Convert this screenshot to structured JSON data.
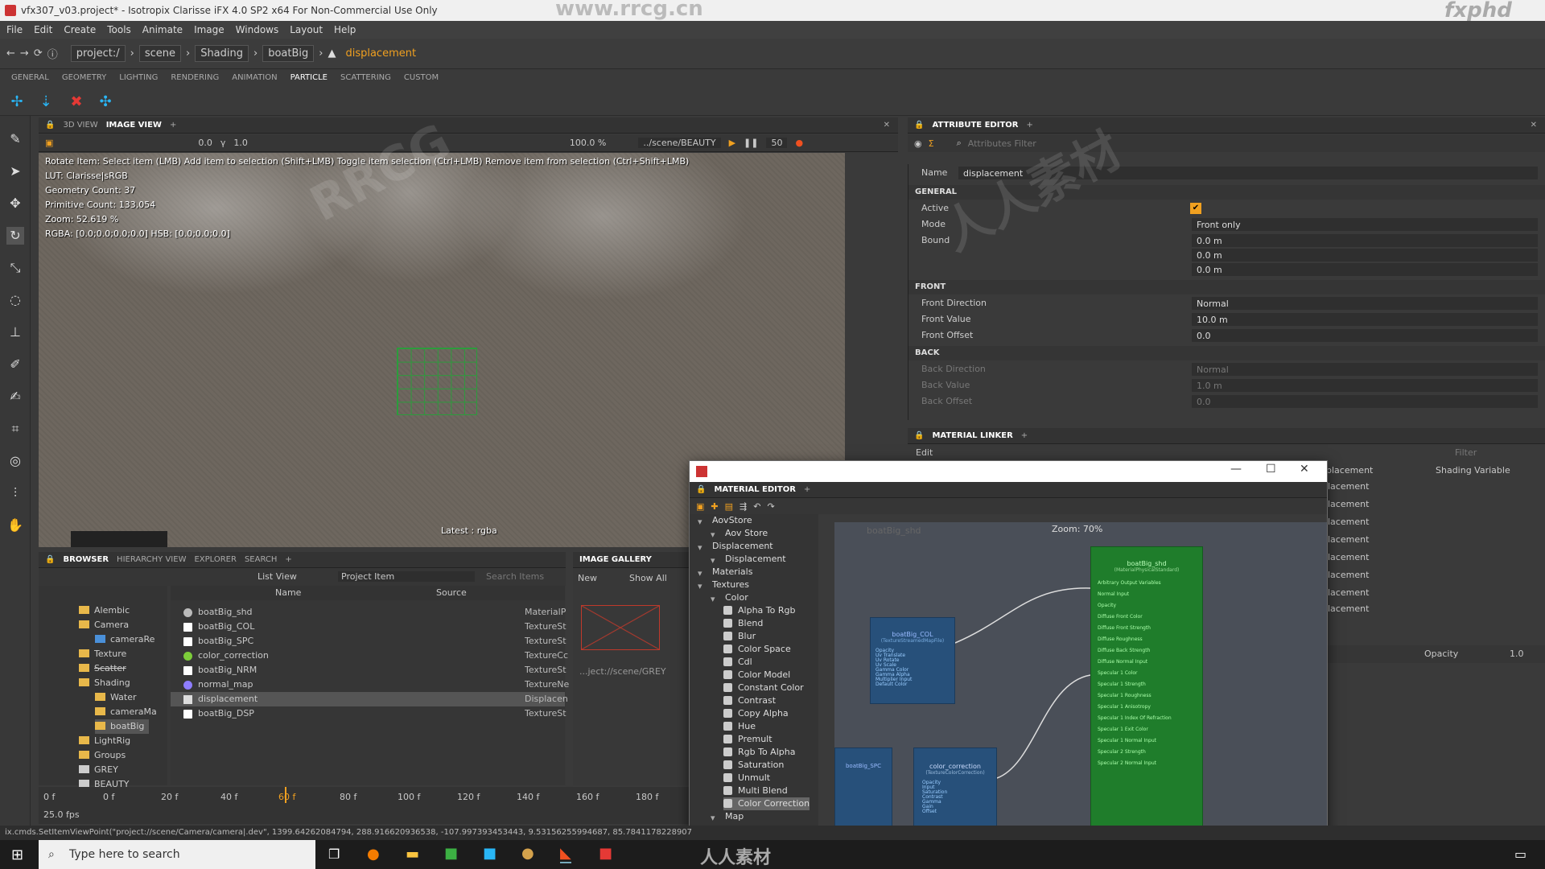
{
  "window": {
    "title": "vfx307_v03.project* - Isotropix Clarisse iFX 4.0 SP2 x64  For Non-Commercial Use Only"
  },
  "watermarks": {
    "site": "www.rrcg.cn",
    "brand": "fxphd",
    "rrcg": "RRCG",
    "cn": "人人素材",
    "footer": "人人素材"
  },
  "menu": [
    "File",
    "Edit",
    "Create",
    "Tools",
    "Animate",
    "Image",
    "Windows",
    "Layout",
    "Help"
  ],
  "breadcrumb": [
    "project:/",
    "scene",
    "Shading",
    "boatBig",
    "displacement"
  ],
  "shelf_tabs": [
    "GENERAL",
    "GEOMETRY",
    "LIGHTING",
    "RENDERING",
    "ANIMATION",
    "PARTICLE",
    "SCATTERING",
    "CUSTOM"
  ],
  "viewport": {
    "tabs": [
      "3D VIEW",
      "IMAGE VIEW"
    ],
    "toolbar": {
      "exposure": "0.0",
      "gamma": "1.0",
      "zoom": "100.0 %",
      "image_path": "../scene/BEAUTY",
      "percent": "50"
    },
    "hud": [
      "Rotate Item: Select item (LMB) Add item to selection (Shift+LMB) Toggle item selection (Ctrl+LMB) Remove item from selection (Ctrl+Shift+LMB)",
      "LUT: Clarisse|sRGB",
      "Geometry Count: 37",
      "Primitive Count: 133,054",
      "Zoom: 52.619 %",
      "RGBA: [0.0;0.0;0.0;0.0] HSB: [0.0;0.0;0.0]"
    ],
    "layer_label": "Latest : rgba"
  },
  "attribute_editor": {
    "tab": "ATTRIBUTE EDITOR",
    "filter_placeholder": "Attributes Filter",
    "name_label": "Name",
    "name_value": "displacement",
    "sections": {
      "general": "GENERAL",
      "front": "FRONT",
      "back": "BACK"
    },
    "general": [
      {
        "label": "Active",
        "value": "✔"
      },
      {
        "label": "Mode",
        "value": "Front only"
      },
      {
        "label": "Bound",
        "value": "0.0 m"
      },
      {
        "label": "",
        "value": "0.0 m"
      },
      {
        "label": "",
        "value": "0.0 m"
      }
    ],
    "front": [
      {
        "label": "Front Direction",
        "value": "Normal"
      },
      {
        "label": "Front Value",
        "value": "10.0 m"
      },
      {
        "label": "Front Offset",
        "value": "0.0"
      }
    ],
    "back": [
      {
        "label": "Back Direction",
        "value": "Normal"
      },
      {
        "label": "Back Value",
        "value": "1.0 m"
      },
      {
        "label": "Back Offset",
        "value": "0.0"
      }
    ]
  },
  "material_linker": {
    "tab": "MATERIAL LINKER",
    "edit": "Edit",
    "filter": "Filter",
    "col_placement": "placement",
    "col_shading": "Shading Variable",
    "rows": [
      "lacement",
      "lacement",
      "lacement",
      "lacement",
      "lacement",
      "lacement",
      "lacement",
      "lacement"
    ],
    "opacity_label": "Opacity",
    "opacity_value": "1.0"
  },
  "browser": {
    "tabs": [
      "BROWSER",
      "HIERARCHY VIEW",
      "EXPLORER",
      "SEARCH"
    ],
    "view_mode": "List View",
    "project_item": "Project Item",
    "search_placeholder": "Search Items",
    "tree": [
      {
        "label": "Alembic",
        "d": 1
      },
      {
        "label": "Camera",
        "d": 1
      },
      {
        "label": "cameraRe",
        "d": 2
      },
      {
        "label": "Texture",
        "d": 1
      },
      {
        "label": "Scatter",
        "d": 1
      },
      {
        "label": "Shading",
        "d": 1
      },
      {
        "label": "Water",
        "d": 2
      },
      {
        "label": "cameraMa",
        "d": 2
      },
      {
        "label": "boatBig",
        "d": 2
      },
      {
        "label": "LightRig",
        "d": 1
      },
      {
        "label": "Groups",
        "d": 1
      },
      {
        "label": "GREY",
        "d": 1
      },
      {
        "label": "BEAUTY",
        "d": 1
      }
    ],
    "columns": [
      "Name",
      "Source"
    ],
    "files": [
      {
        "name": "boatBig_shd",
        "src": "MaterialP",
        "c": "#bbbbbb"
      },
      {
        "name": "boatBig_COL",
        "src": "TextureSt",
        "c": "#ffffff"
      },
      {
        "name": "boatBig_SPC",
        "src": "TextureSt",
        "c": "#ffffff"
      },
      {
        "name": "color_correction",
        "src": "TextureCc",
        "c": "#7ccd3a"
      },
      {
        "name": "boatBig_NRM",
        "src": "TextureSt",
        "c": "#ffffff"
      },
      {
        "name": "normal_map",
        "src": "TextureNe",
        "c": "#8e7dff"
      },
      {
        "name": "displacement",
        "src": "Displacen",
        "c": "#dddddd"
      },
      {
        "name": "boatBig_DSP",
        "src": "TextureSt",
        "c": "#ffffff"
      }
    ]
  },
  "gallery": {
    "tab": "IMAGE GALLERY",
    "new": "New",
    "show_all": "Show All",
    "path": "...ject://scene/GREY"
  },
  "timeline": {
    "ticks": [
      "0 f",
      "20 f",
      "40 f",
      "60 f",
      "80 f",
      "100 f",
      "120 f",
      "140 f",
      "160 f",
      "180 f"
    ],
    "start": "0 f",
    "fps": "25.0 fps"
  },
  "status": "ix.cmds.SetItemViewPoint(\"project://scene/Camera/camera|.dev\", 1399.64262084794, 288.916620936538, -107.997393453443, 9.53156255994687, 85.7841178228907",
  "material_editor": {
    "tab": "MATERIAL EDITOR",
    "zoom": "Zoom: 70%",
    "list": [
      {
        "t": "AovStore",
        "d": 0
      },
      {
        "t": "Aov Store",
        "d": 1
      },
      {
        "t": "Displacement",
        "d": 0
      },
      {
        "t": "Displacement",
        "d": 1
      },
      {
        "t": "Materials",
        "d": 0
      },
      {
        "t": "Textures",
        "d": 0
      },
      {
        "t": "Color",
        "d": 1
      },
      {
        "t": "Alpha To Rgb",
        "d": 2
      },
      {
        "t": "Blend",
        "d": 2
      },
      {
        "t": "Blur",
        "d": 2
      },
      {
        "t": "Color Space",
        "d": 2
      },
      {
        "t": "Cdl",
        "d": 2
      },
      {
        "t": "Color Model",
        "d": 2
      },
      {
        "t": "Constant Color",
        "d": 2
      },
      {
        "t": "Contrast",
        "d": 2
      },
      {
        "t": "Copy Alpha",
        "d": 2
      },
      {
        "t": "Hue",
        "d": 2
      },
      {
        "t": "Premult",
        "d": 2
      },
      {
        "t": "Rgb To Alpha",
        "d": 2
      },
      {
        "t": "Saturation",
        "d": 2
      },
      {
        "t": "Unmult",
        "d": 2
      },
      {
        "t": "Multi Blend",
        "d": 2
      },
      {
        "t": "Color Correction",
        "d": 2
      },
      {
        "t": "Map",
        "d": 1
      }
    ],
    "nodes": {
      "shd_label": "boatBig_shd",
      "shd_sub": "(MaterialPhysicalStandard)",
      "col_label": "boatBig_COL",
      "col_sub": "(TextureStreamedMapFile)",
      "spc_label": "boatBig_SPC",
      "cc_label": "color_correction",
      "cc_sub": "(TextureColorCorrection)",
      "canvas_title": "boatBig_shd"
    },
    "shd_ports": [
      "Arbitrary Output Variables",
      "Normal Input",
      "Opacity",
      "Diffuse Front Color",
      "Diffuse Front Strength",
      "Diffuse Roughness",
      "Diffuse Back Strength",
      "Diffuse Normal Input",
      "Specular 1 Color",
      "Specular 1 Strength",
      "Specular 1 Roughness",
      "Specular 1 Anisotropy",
      "Specular 1 Index Of Refraction",
      "Specular 1 Exit Color",
      "Specular 1 Normal Input",
      "Specular 2 Strength",
      "Specular 2 Normal Input"
    ],
    "col_ports": [
      "Opacity",
      "Uv Translate",
      "Uv Rotate",
      "Uv Scale",
      "Gamma Color",
      "Gamma Alpha",
      "Multiplier Input",
      "Default Color"
    ],
    "cc_ports": [
      "Opacity",
      "Input",
      "Saturation",
      "Contrast",
      "Gamma",
      "Gain",
      "Offset"
    ]
  },
  "taskbar": {
    "search": "Type here to search"
  }
}
